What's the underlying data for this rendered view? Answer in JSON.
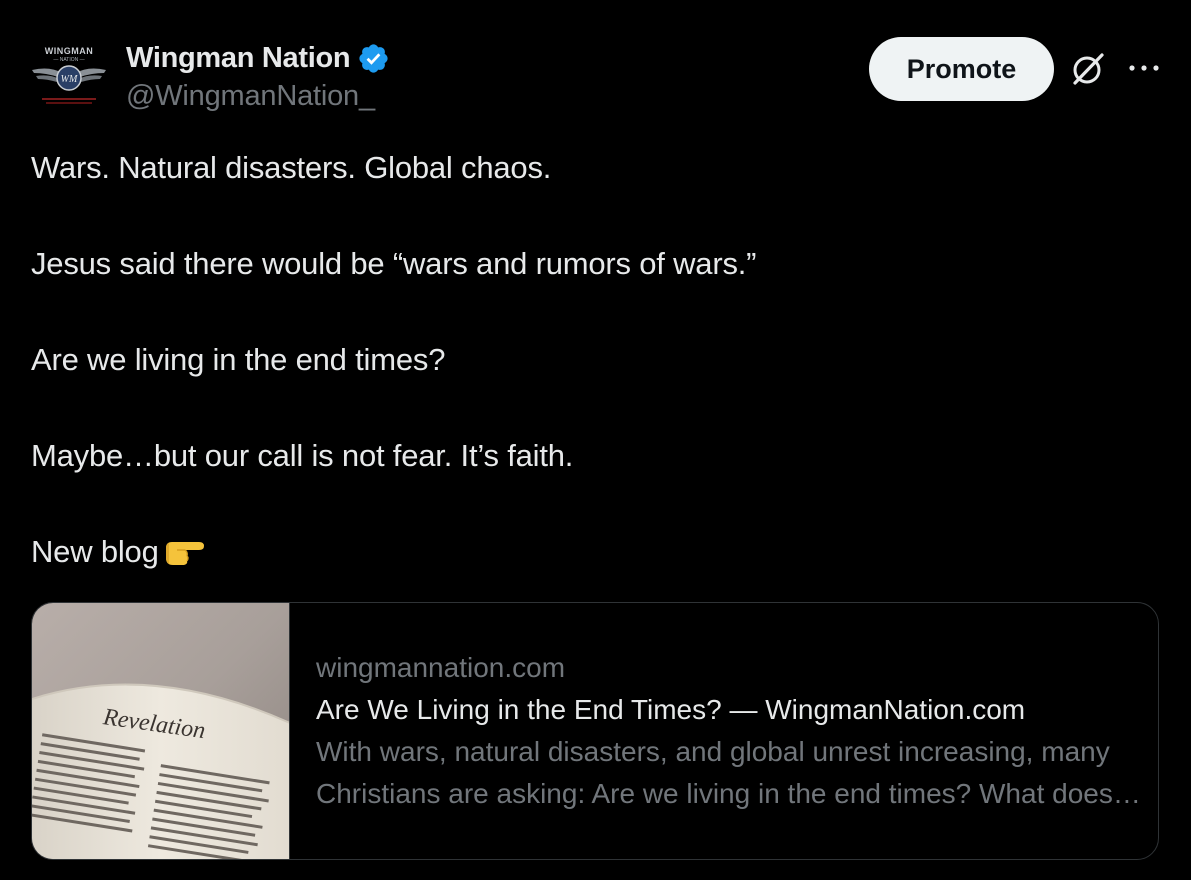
{
  "author": {
    "display_name": "Wingman Nation",
    "handle": "@WingmanNation_",
    "verified": true,
    "avatar_text_top": "WINGMAN",
    "avatar_text_sub": "— NATION —",
    "avatar_monogram": "WM"
  },
  "actions": {
    "promote_label": "Promote",
    "grok_icon": "grok-icon",
    "more_icon": "more-horizontal-icon"
  },
  "tweet": {
    "paragraphs": [
      "Wars. Natural disasters. Global chaos.",
      "Jesus said there would be “wars and rumors of wars.”",
      "Are we living in the end times?",
      "Maybe…but our call is not fear. It’s faith.",
      "New blog"
    ],
    "trailing_emoji": "backhand-index-pointing-right"
  },
  "link_card": {
    "domain": "wingmannation.com",
    "title": "Are We Living in the End Times? — WingmanNation.com",
    "description": "With wars, natural disasters, and global unrest increasing, many Christians are asking: Are we living in the end times? What does the Bible actually say about the last days, and how should believers respond?",
    "thumbnail_heading": "Revelation",
    "thumbnail_alt": "open-bible-page-revelation"
  },
  "colors": {
    "background": "#000000",
    "text_primary": "#e7e9ea",
    "text_secondary": "#71767b",
    "verified_blue": "#1d9bf0",
    "border": "#2f3336",
    "promote_bg": "#eff3f4"
  }
}
